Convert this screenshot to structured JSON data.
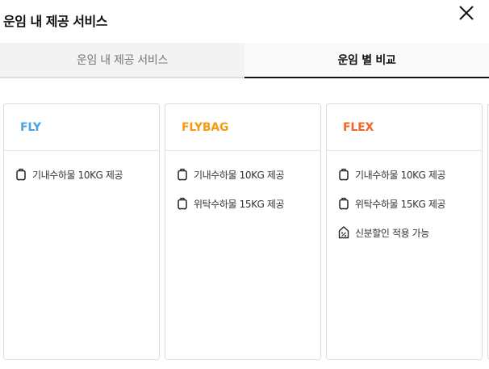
{
  "header": {
    "title": "운임 내 제공 서비스"
  },
  "tabs": [
    {
      "label": "운임 내 제공 서비스",
      "active": false
    },
    {
      "label": "운임 별 비교",
      "active": true
    }
  ],
  "fares": [
    {
      "name": "FLY",
      "color": "#4aa3df",
      "features": [
        {
          "icon": "carry-on-bag-icon",
          "text": "기내수하물 10KG 제공"
        }
      ]
    },
    {
      "name": "FLYBAG",
      "color": "#f39c12",
      "features": [
        {
          "icon": "carry-on-bag-icon",
          "text": "기내수하물 10KG 제공"
        },
        {
          "icon": "checked-bag-icon",
          "text": "위탁수하물 15KG 제공"
        }
      ]
    },
    {
      "name": "FLEX",
      "color": "#f26522",
      "features": [
        {
          "icon": "carry-on-bag-icon",
          "text": "기내수하물 10KG 제공"
        },
        {
          "icon": "checked-bag-icon",
          "text": "위탁수하물 15KG 제공"
        },
        {
          "icon": "discount-tag-icon",
          "text": "신분할인 적용 가능"
        }
      ]
    }
  ]
}
